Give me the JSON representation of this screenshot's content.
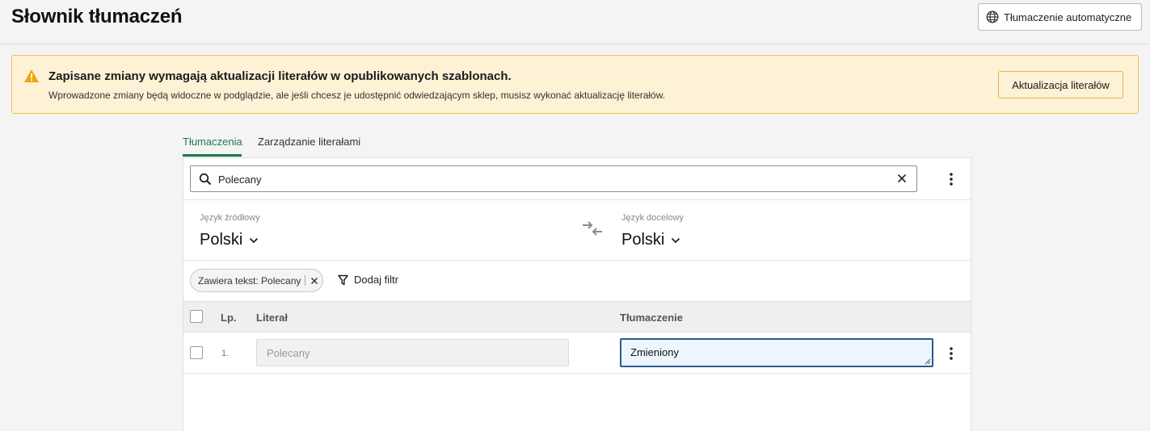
{
  "header": {
    "title": "Słownik tłumaczeń",
    "auto_translate_label": "Tłumaczenie automatyczne"
  },
  "alert": {
    "title": "Zapisane zmiany wymagają aktualizacji literałów w opublikowanych szablonach.",
    "description": "Wprowadzone zmiany będą widoczne w podglądzie, ale jeśli chcesz je udostępnić odwiedzającym sklep, musisz wykonać aktualizację literałów.",
    "button_label": "Aktualizacja literałów",
    "accent": "#f2c24f"
  },
  "tabs": [
    {
      "label": "Tłumaczenia",
      "active": true
    },
    {
      "label": "Zarządzanie literałami",
      "active": false
    }
  ],
  "search": {
    "value": "Polecany"
  },
  "languages": {
    "source_label": "Język źródłowy",
    "source_value": "Polski",
    "target_label": "Język docelowy",
    "target_value": "Polski"
  },
  "filters": {
    "chip_label": "Zawiera tekst: Polecany",
    "add_filter_label": "Dodaj filtr"
  },
  "table": {
    "columns": [
      "Lp.",
      "Literał",
      "Tłumaczenie"
    ],
    "rows": [
      {
        "lp": "1.",
        "literal": "Polecany",
        "translation": "Zmieniony"
      }
    ]
  },
  "colors": {
    "accent_green": "#1a7a4a",
    "focus_blue": "#2a5a8f"
  }
}
